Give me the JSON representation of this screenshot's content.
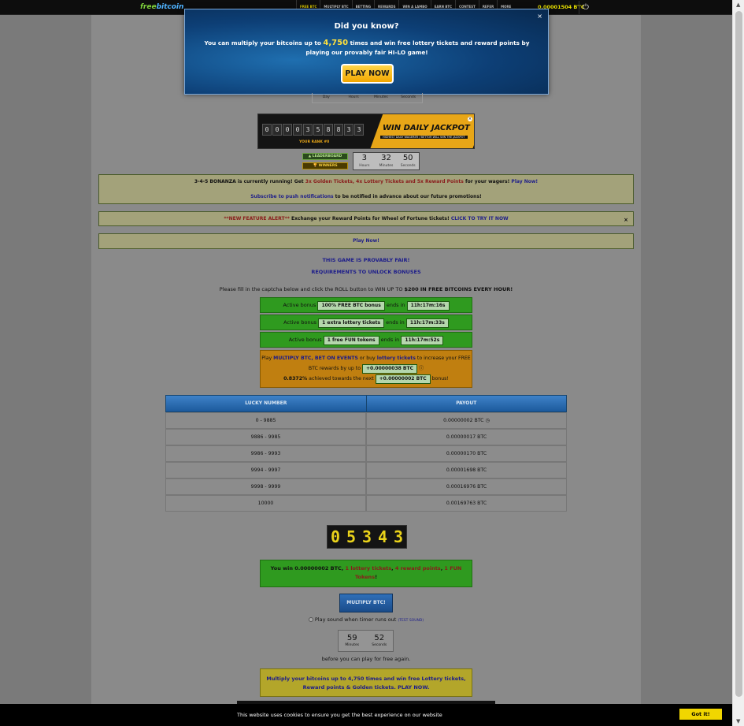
{
  "nav": {
    "logo_part1": "free",
    "logo_part2": "bitcoin",
    "links": [
      "FREE BTC",
      "MULTIPLY BTC",
      "BETTING",
      "REWARDS",
      "WIN A LAMBO",
      "EARN BTC",
      "CONTEST",
      "REFER",
      "MORE"
    ],
    "balance": "0.00001504 BTC"
  },
  "modal": {
    "title": "Did you know?",
    "text_before": "You can multiply your bitcoins up to ",
    "highlight": "4,750",
    "text_after": " times and win free lottery tickets and reward points by playing our provably fair HI-LO game!",
    "button": "PLAY NOW"
  },
  "top_countdown": {
    "day": "Day",
    "hours": "Hours",
    "minutes": "Minutes",
    "seconds": "Seconds"
  },
  "jackpot": {
    "digits": [
      "0",
      "0",
      "0",
      "0",
      "3",
      "5",
      "8",
      "8",
      "3",
      "3"
    ],
    "title": "WIN DAILY JACKPOT",
    "subtitle": "HIGHEST DAILY WAGERER / BETTOR WILL WIN THE JACKPOT",
    "rank": "YOUR RANK #0"
  },
  "leaderboard_label": "LEADERBOARD",
  "winners_label": "WINNERS",
  "jackpot_timer": {
    "hours": "3",
    "hours_label": "Hours",
    "minutes": "32",
    "minutes_label": "Minutes",
    "seconds": "50",
    "seconds_label": "Seconds"
  },
  "bonanza": {
    "text1": "3-4-5 BONANZA is currently running! Get ",
    "highlight": "3x Golden Tickets, 4x Lottery Tickets and 5x Reward Points",
    "text2": " for your wagers! ",
    "link": "Play Now!",
    "subscribe_link": "Subscribe to push notifications",
    "subscribe_text": " to be notified in advance about our future promotions!"
  },
  "feature_alert": {
    "tag": "**NEW FEATURE ALERT**",
    "text": " Exchange your Reward Points for Wheel of Fortune tickets! ",
    "link": "CLICK TO TRY IT NOW"
  },
  "play_now_bar": "Play Now!",
  "provably_fair": "THIS GAME IS PROVABLY FAIR!",
  "requirements": "REQUIREMENTS TO UNLOCK BONUSES",
  "captcha_text": "Please fill in the captcha below and click the ROLL button to WIN UP TO ",
  "captcha_highlight": "$200 IN FREE BITCOINS EVERY HOUR!",
  "bonuses": [
    {
      "prefix": "Active bonus",
      "name": "100% FREE BTC bonus",
      "ends": "ends in",
      "time": "11h:17m:16s"
    },
    {
      "prefix": "Active bonus",
      "name": "1 extra lottery tickets",
      "ends": "ends in",
      "time": "11h:17m:33s"
    },
    {
      "prefix": "Active bonus",
      "name": "1 free FUN tokens",
      "ends": "ends in",
      "time": "11h:17m:52s"
    }
  ],
  "progress": {
    "t1": "Play ",
    "l1": "MULTIPLY BTC, BET ON EVENTS",
    "t2": " or buy ",
    "l2": "lottery tickets",
    "t3": " to increase your FREE BTC rewards by up to ",
    "reward": "+0.00000038 BTC",
    "percent": "0.8372%",
    "t4": " achieved towards the next ",
    "next": "+0.00000002 BTC",
    "t5": " bonus!"
  },
  "table": {
    "headers": [
      "LUCKY NUMBER",
      "PAYOUT"
    ],
    "lucky": [
      "0 - 9885",
      "9886 - 9985",
      "9986 - 9993",
      "9994 - 9997",
      "9998 - 9999",
      "10000"
    ],
    "payout": [
      "0.00000002 BTC",
      "0.00000017 BTC",
      "0.00000170 BTC",
      "0.00001698 BTC",
      "0.00016976 BTC",
      "0.00169763 BTC"
    ]
  },
  "roll_digits": [
    "0",
    "5",
    "3",
    "4",
    "3"
  ],
  "win": {
    "t1": "You win 0.00000002 BTC, ",
    "r1": "1 lottery tickets",
    "t2": ", ",
    "r2": "4 reward points",
    "t3": ", ",
    "r3": "1 FUN Tokens",
    "t4": "!"
  },
  "multiply_button": "MULTIPLY BTC!",
  "sound": {
    "label": "Play sound when timer runs out",
    "test": "(TEST SOUND)"
  },
  "free_timer": {
    "minutes": "59",
    "minutes_label": "Minutes",
    "seconds": "52",
    "seconds_label": "Seconds"
  },
  "before_text": "before you can play for free again.",
  "promo": "Multiply your bitcoins up to 4,750 times and win free Lottery tickets, Reward points & Golden tickets. PLAY NOW.",
  "cookie": {
    "text": "This website uses cookies to ensure you get the best experience on our website",
    "button": "Got it!"
  }
}
